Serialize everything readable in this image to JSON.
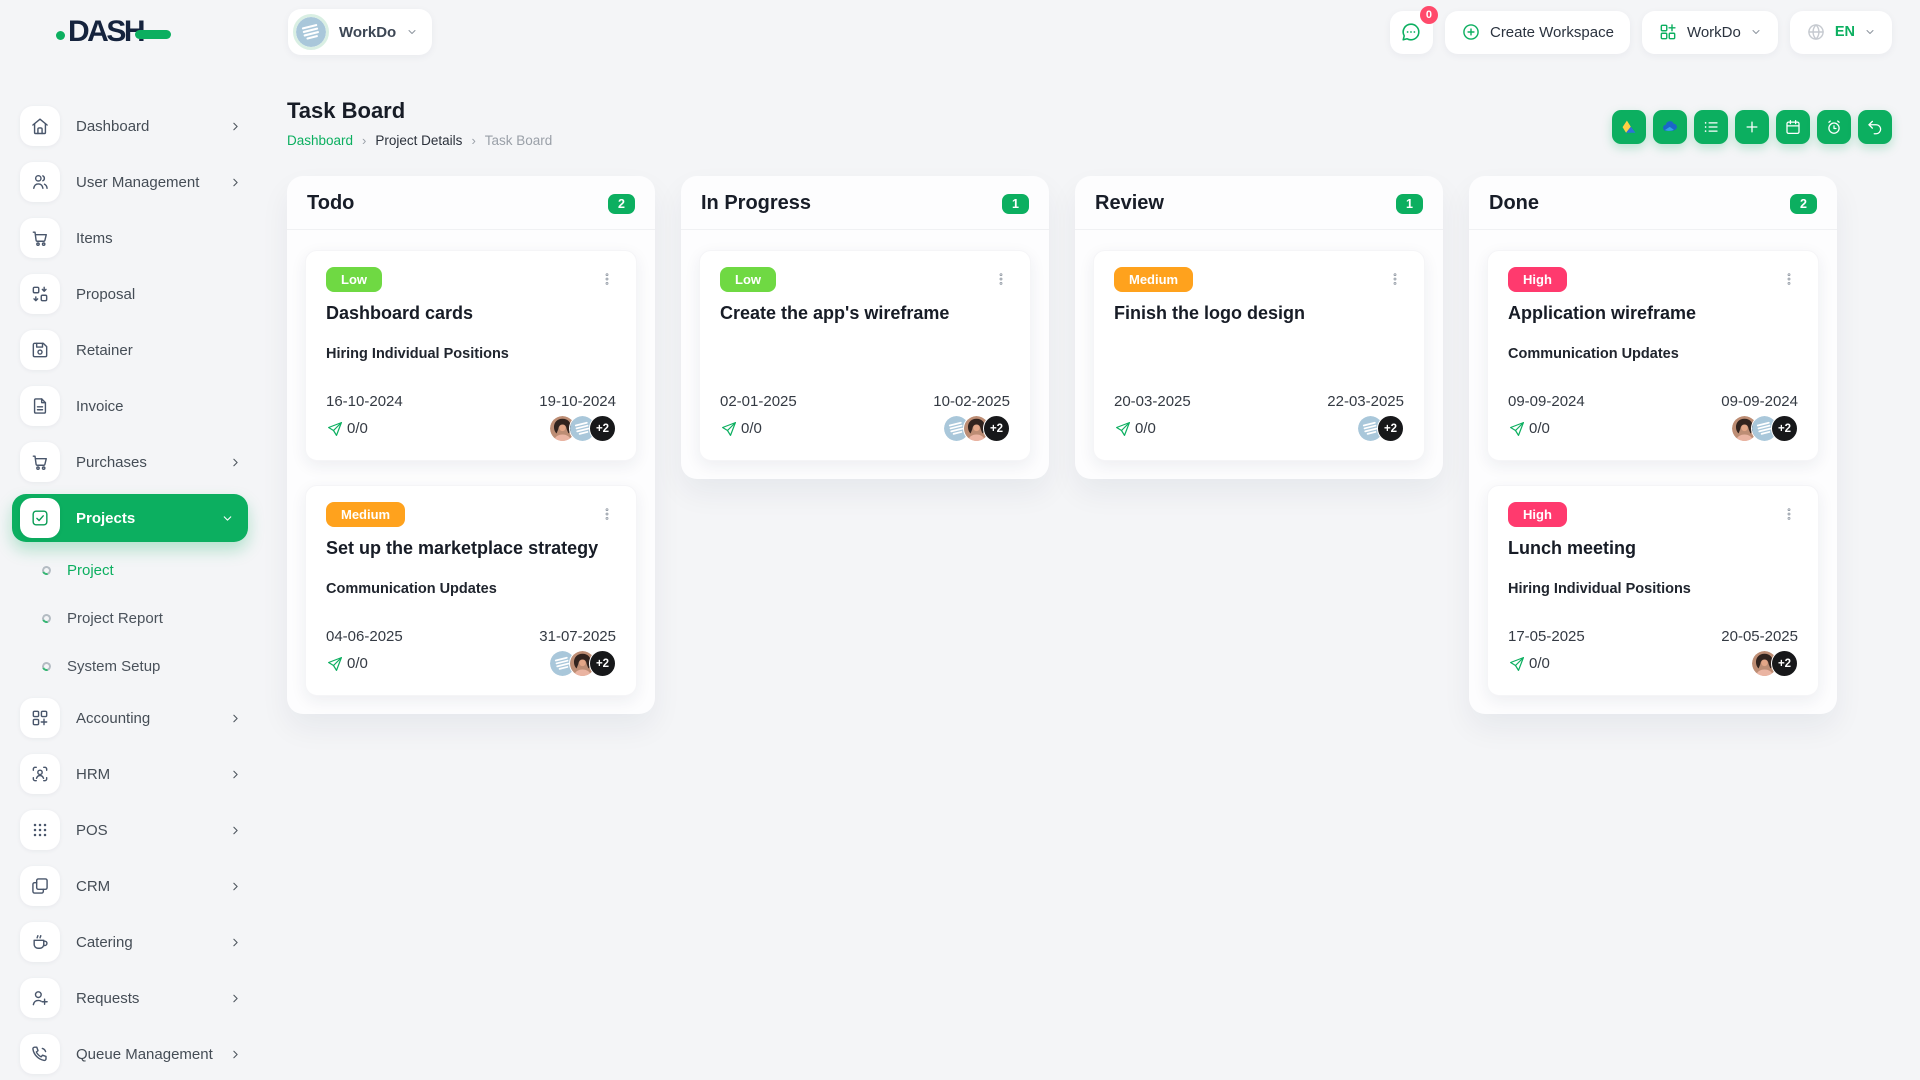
{
  "brand": {
    "name": "DASH"
  },
  "header": {
    "workspace": {
      "label": "WorkDo"
    },
    "messages": {
      "badge": "0"
    },
    "create_workspace": {
      "label": "Create Workspace"
    },
    "app_menu": {
      "label": "WorkDo"
    },
    "language": {
      "label": "EN"
    }
  },
  "page": {
    "title": "Task Board",
    "breadcrumb": [
      {
        "label": "Dashboard"
      },
      {
        "label": "Project Details"
      },
      {
        "label": "Task Board"
      }
    ],
    "toolbar": [
      {
        "name": "google-drive",
        "icon": "gdrive"
      },
      {
        "name": "one-drive",
        "icon": "onedrive"
      },
      {
        "name": "list",
        "icon": "list"
      },
      {
        "name": "add",
        "icon": "add"
      },
      {
        "name": "calendar",
        "icon": "calendar"
      },
      {
        "name": "timer",
        "icon": "timer"
      },
      {
        "name": "undo",
        "icon": "undo"
      }
    ]
  },
  "sidebar": {
    "items": [
      {
        "label": "Dashboard",
        "icon": "home",
        "chevron": true
      },
      {
        "label": "User Management",
        "icon": "users",
        "chevron": true
      },
      {
        "label": "Items",
        "icon": "cart",
        "chevron": false
      },
      {
        "label": "Proposal",
        "icon": "proposal",
        "chevron": false
      },
      {
        "label": "Retainer",
        "icon": "retainer",
        "chevron": false
      },
      {
        "label": "Invoice",
        "icon": "invoice",
        "chevron": false
      },
      {
        "label": "Purchases",
        "icon": "cart",
        "chevron": true
      },
      {
        "label": "Projects",
        "icon": "projects",
        "chevron": true,
        "active": true,
        "expanded": true,
        "children": [
          {
            "label": "Project",
            "active": true
          },
          {
            "label": "Project Report"
          },
          {
            "label": "System Setup"
          }
        ]
      },
      {
        "label": "Accounting",
        "icon": "accounting",
        "chevron": true
      },
      {
        "label": "HRM",
        "icon": "hrm",
        "chevron": true
      },
      {
        "label": "POS",
        "icon": "pos",
        "chevron": true
      },
      {
        "label": "CRM",
        "icon": "crm",
        "chevron": true
      },
      {
        "label": "Catering",
        "icon": "catering",
        "chevron": true
      },
      {
        "label": "Requests",
        "icon": "requests",
        "chevron": true
      },
      {
        "label": "Queue Management",
        "icon": "queue",
        "chevron": true
      }
    ]
  },
  "board": {
    "columns": [
      {
        "name": "Todo",
        "count": "2",
        "cards": [
          {
            "priority": "Low",
            "title": "Dashboard cards",
            "milestone": "Hiring Individual Positions",
            "start_date": "16-10-2024",
            "end_date": "19-10-2024",
            "progress": "0/0",
            "avatars": [
              "person-photo",
              "workspace-logo"
            ],
            "extra_count": "+2"
          },
          {
            "priority": "Medium",
            "title": "Set up the marketplace strategy",
            "milestone": "Communication Updates",
            "start_date": "04-06-2025",
            "end_date": "31-07-2025",
            "progress": "0/0",
            "avatars": [
              "workspace-logo",
              "person-photo"
            ],
            "extra_count": "+2"
          }
        ]
      },
      {
        "name": "In Progress",
        "count": "1",
        "cards": [
          {
            "priority": "Low",
            "title": "Create the app's wireframe",
            "milestone": "",
            "start_date": "02-01-2025",
            "end_date": "10-02-2025",
            "progress": "0/0",
            "avatars": [
              "workspace-logo",
              "person-photo"
            ],
            "extra_count": "+2"
          }
        ]
      },
      {
        "name": "Review",
        "count": "1",
        "cards": [
          {
            "priority": "Medium",
            "title": "Finish the logo design",
            "milestone": "",
            "start_date": "20-03-2025",
            "end_date": "22-03-2025",
            "progress": "0/0",
            "avatars": [
              "workspace-logo"
            ],
            "extra_count": "+2"
          }
        ]
      },
      {
        "name": "Done",
        "count": "2",
        "cards": [
          {
            "priority": "High",
            "title": "Application wireframe",
            "milestone": "Communication Updates",
            "start_date": "09-09-2024",
            "end_date": "09-09-2024",
            "progress": "0/0",
            "avatars": [
              "person-photo",
              "workspace-logo"
            ],
            "extra_count": "+2"
          },
          {
            "priority": "High",
            "title": "Lunch meeting",
            "milestone": "Hiring Individual Positions",
            "start_date": "17-05-2025",
            "end_date": "20-05-2025",
            "progress": "0/0",
            "avatars": [
              "person-photo"
            ],
            "extra_count": "+2"
          }
        ]
      }
    ]
  },
  "colors": {
    "primary_green": "#0CAF60",
    "priority_low": "#6FD943",
    "priority_medium": "#FFA21D",
    "priority_high": "#FF3A6E",
    "badge_dark": "#17181A",
    "notification_pink": "#FF4A6B",
    "avatar_blue": "#A9C7DA"
  }
}
